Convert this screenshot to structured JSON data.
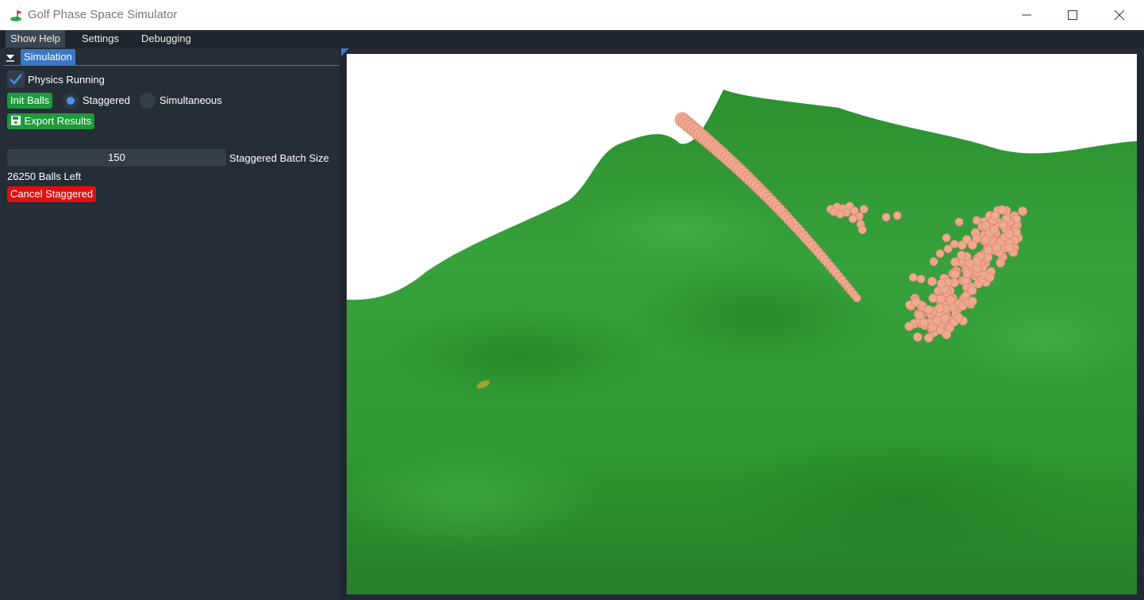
{
  "window": {
    "title": "Golf Phase Space Simulator",
    "icon": "golf-flag-icon",
    "controls": [
      "minimize-icon",
      "maximize-icon",
      "close-icon"
    ]
  },
  "menubar": {
    "items": [
      {
        "label": "Show Help",
        "active": true
      },
      {
        "label": "Settings",
        "active": false
      },
      {
        "label": "Debugging",
        "active": false
      }
    ]
  },
  "simulation_panel": {
    "tab_label": "Simulation",
    "physics_running": {
      "label": "Physics Running",
      "checked": true
    },
    "init_balls_label": "Init Balls",
    "mode_options": [
      {
        "label": "Staggered",
        "selected": true
      },
      {
        "label": "Simultaneous",
        "selected": false
      }
    ],
    "export_label": "Export Results",
    "batch_size": {
      "value": "150",
      "label": "Staggered Batch Size"
    },
    "balls_left": "26250 Balls Left",
    "cancel_label": "Cancel Staggered"
  },
  "colors": {
    "panel_bg": "#252d37",
    "accent_blue": "#3a78c4",
    "button_green": "#1d9a3b",
    "button_red": "#e01010",
    "terrain_green": "#35a03a",
    "ball_salmon": "#f0a890"
  }
}
